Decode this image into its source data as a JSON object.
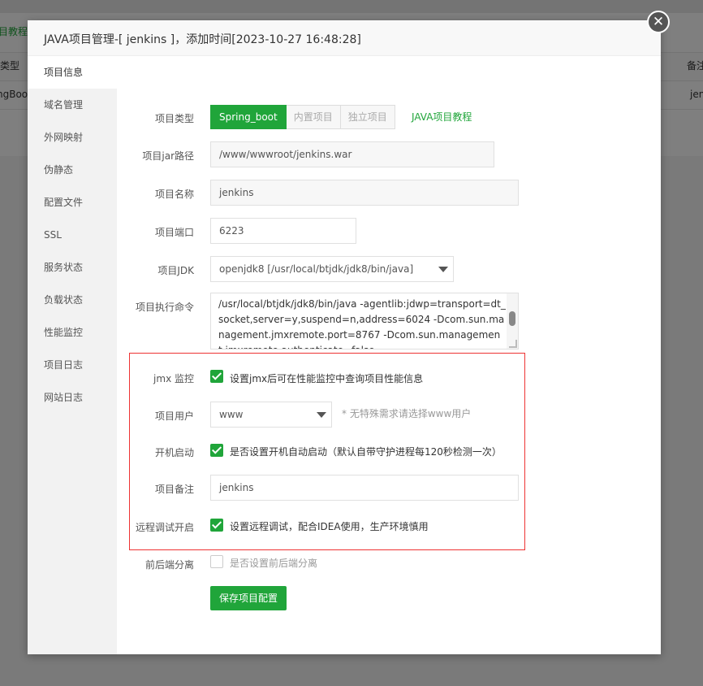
{
  "background": {
    "link_text": "目教程",
    "header_left": "类型",
    "header_right": "备注",
    "row_left": "ngBoo",
    "row_right": "jen"
  },
  "modal": {
    "title": "JAVA项目管理-[ jenkins ]，添加时间[2023-10-27 16:48:28]",
    "close_symbol": "✕"
  },
  "sidebar": {
    "items": [
      {
        "label": "项目信息"
      },
      {
        "label": "域名管理"
      },
      {
        "label": "外网映射"
      },
      {
        "label": "伪静态"
      },
      {
        "label": "配置文件"
      },
      {
        "label": "SSL"
      },
      {
        "label": "服务状态"
      },
      {
        "label": "负载状态"
      },
      {
        "label": "性能监控"
      },
      {
        "label": "项目日志"
      },
      {
        "label": "网站日志"
      }
    ]
  },
  "form": {
    "project_type": {
      "label": "项目类型",
      "options": [
        "Spring_boot",
        "内置项目",
        "独立项目"
      ],
      "selected": "Spring_boot",
      "tutorial": "JAVA项目教程"
    },
    "jar_path": {
      "label": "项目jar路径",
      "value": "/www/wwwroot/jenkins.war"
    },
    "name": {
      "label": "项目名称",
      "value": "jenkins"
    },
    "port": {
      "label": "项目端口",
      "value": "6223"
    },
    "jdk": {
      "label": "项目JDK",
      "value": "openjdk8 [/usr/local/btjdk/jdk8/bin/java]"
    },
    "command": {
      "label": "项目执行命令",
      "value": "/usr/local/btjdk/jdk8/bin/java -agentlib:jdwp=transport=dt_socket,server=y,suspend=n,address=6024 -Dcom.sun.management.jmxremote.port=8767 -Dcom.sun.management.jmxremote.authenticate=false"
    },
    "jmx": {
      "label": "jmx 监控",
      "checked": true,
      "text": "设置jmx后可在性能监控中查询项目性能信息"
    },
    "user": {
      "label": "项目用户",
      "value": "www",
      "hint": "* 无特殊需求请选择www用户"
    },
    "autostart": {
      "label": "开机启动",
      "checked": true,
      "text": "是否设置开机自动启动（默认自带守护进程每120秒检测一次）"
    },
    "remark": {
      "label": "项目备注",
      "value": "jenkins"
    },
    "remote_debug": {
      "label": "远程调试开启",
      "checked": true,
      "text": "设置远程调试，配合IDEA使用，生产环境慎用"
    },
    "separation": {
      "label": "前后端分离",
      "checked": false,
      "text": "是否设置前后端分离"
    },
    "save_label": "保存项目配置"
  },
  "colors": {
    "accent": "#20a53a",
    "highlight_border": "#e33333"
  }
}
